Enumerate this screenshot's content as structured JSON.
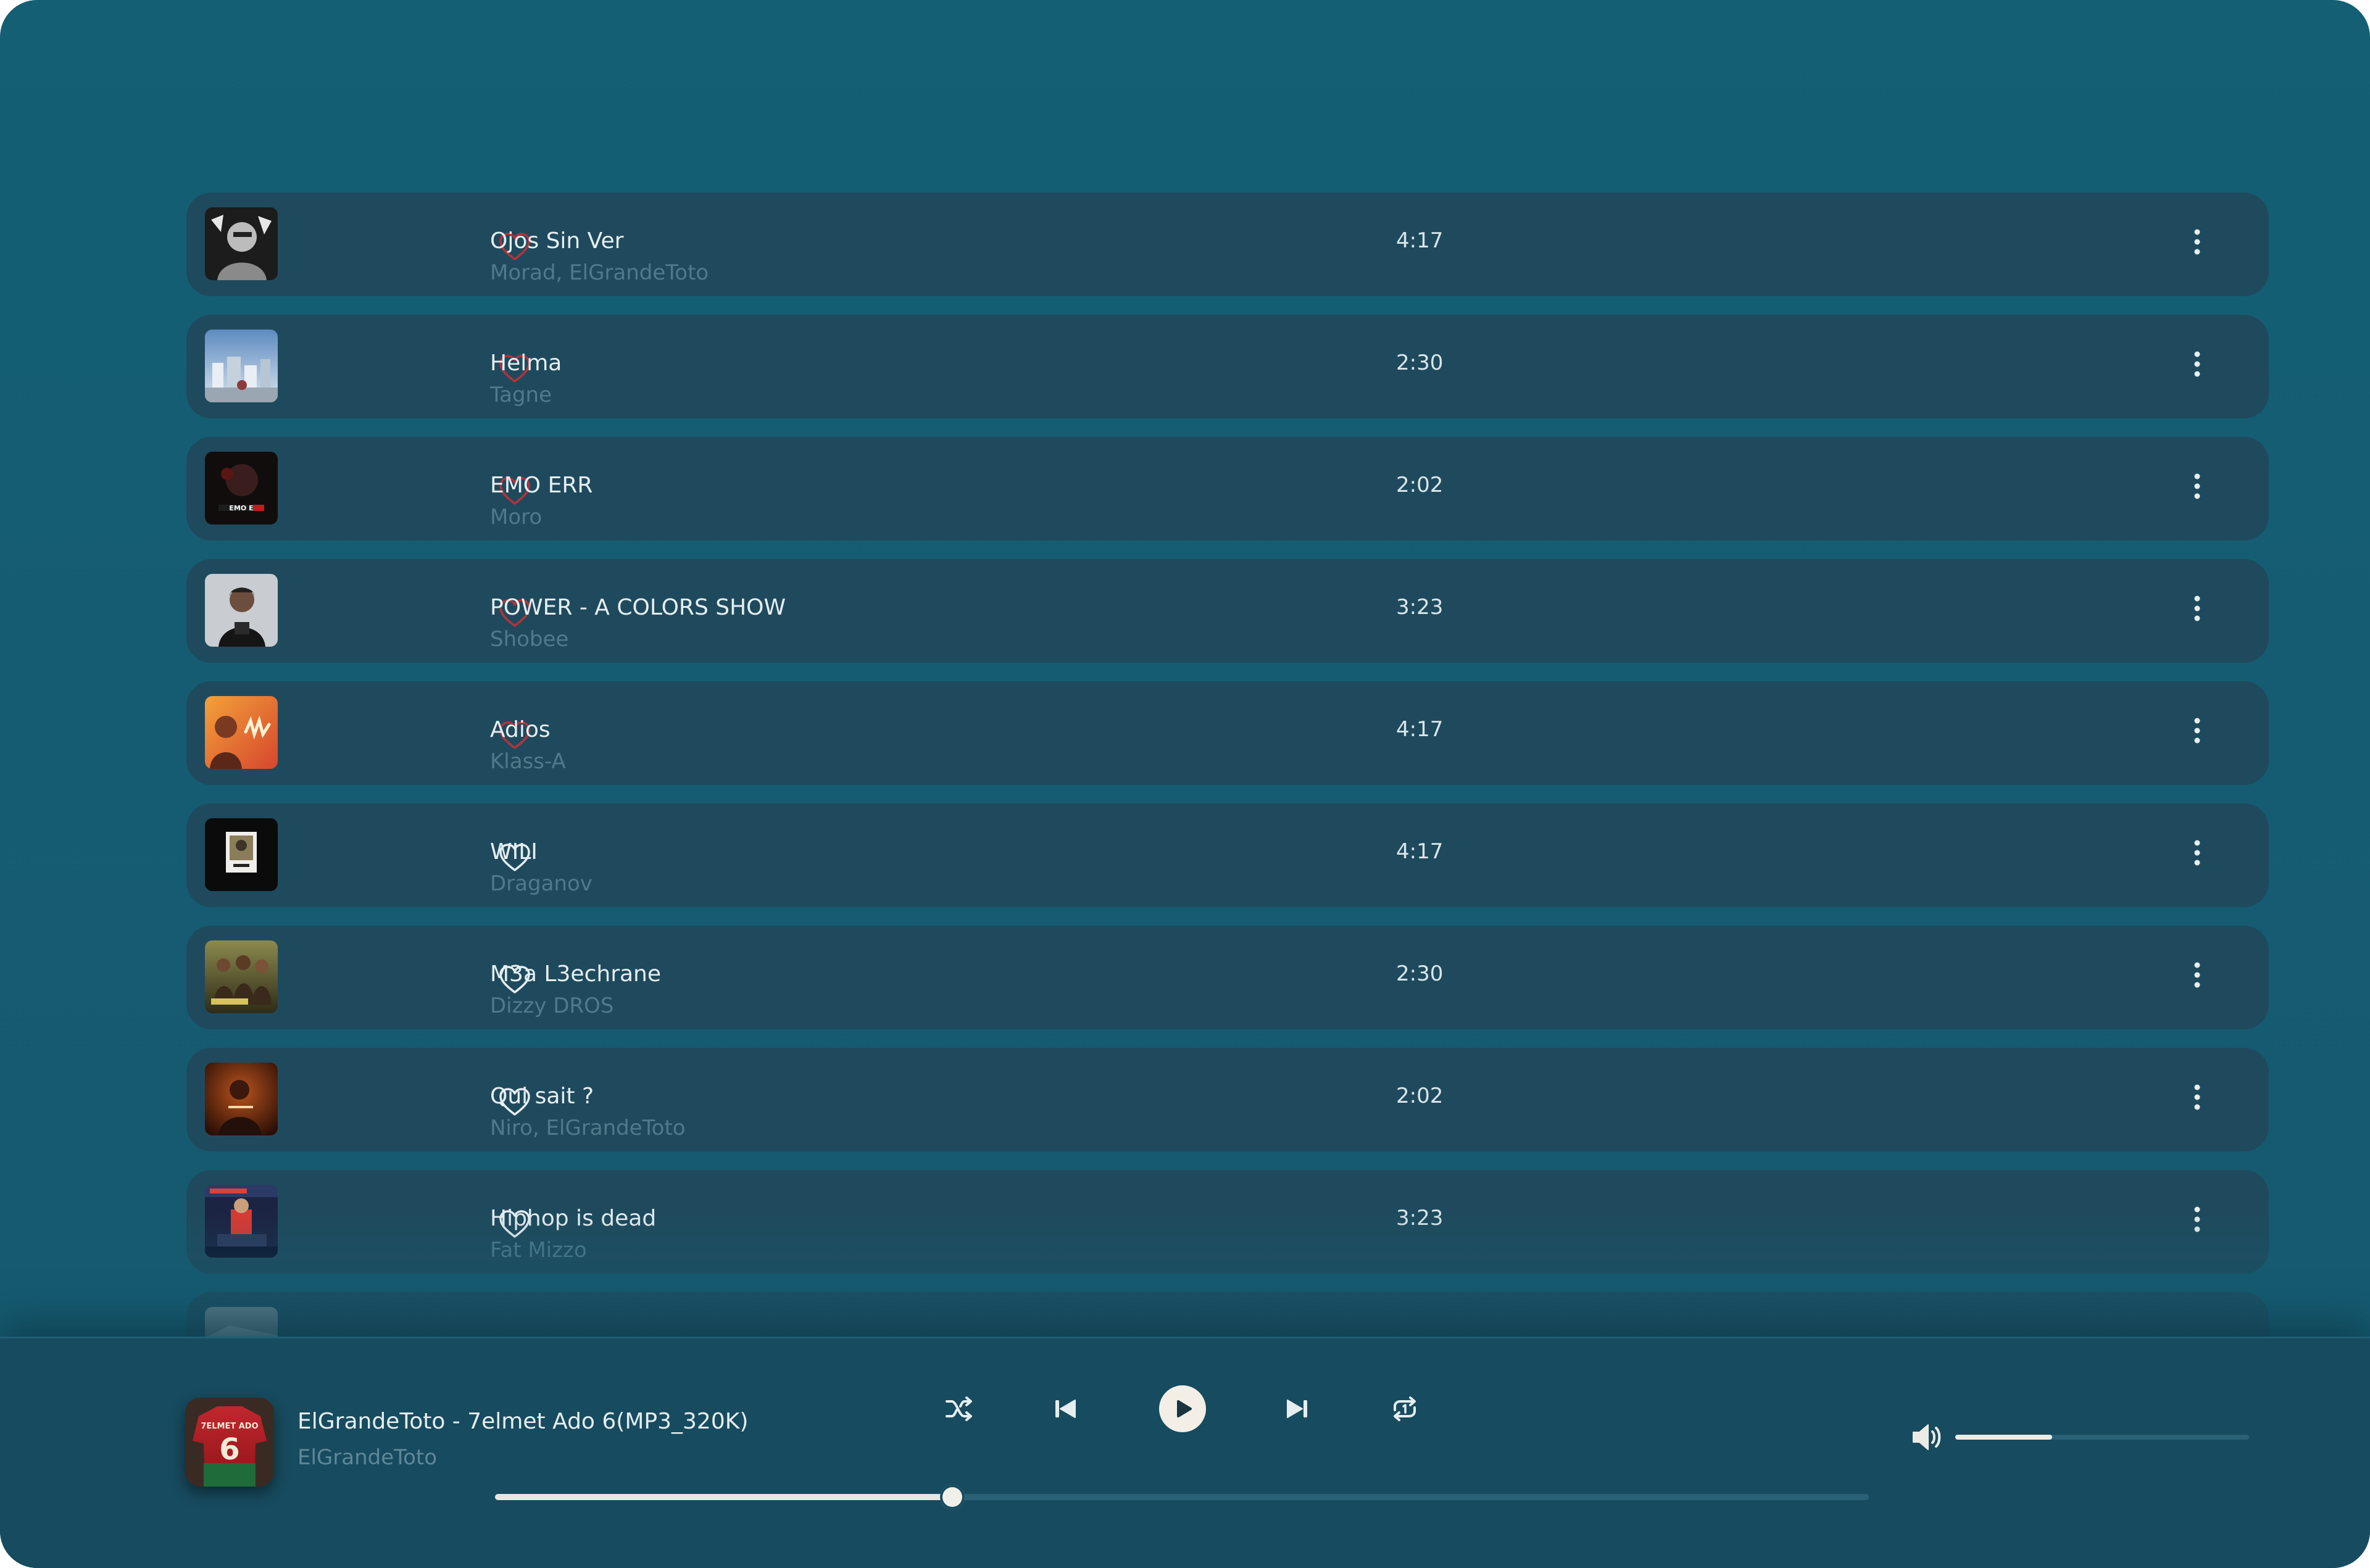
{
  "colors": {
    "background": "#145f74",
    "row": "#1f4a5d",
    "player": "#174b5f",
    "heart_liked": "#b4333a",
    "heart_default": "#e6eef2",
    "text_primary": "#e6eef2",
    "text_secondary": "#4e7a8c"
  },
  "songs": [
    {
      "title": "Ojos Sin Ver",
      "artist": "Morad, ElGrandeToto",
      "duration": "4:17",
      "liked": true,
      "cover": "bw-portrait"
    },
    {
      "title": "Helma",
      "artist": "Tagne",
      "duration": "2:30",
      "liked": true,
      "cover": "city-sky"
    },
    {
      "title": "EMO ERR",
      "artist": "Moro",
      "duration": "2:02",
      "liked": true,
      "cover": "dark-red"
    },
    {
      "title": "POWER - A COLORS SHOW",
      "artist": "Shobee",
      "duration": "3:23",
      "liked": true,
      "cover": "grey-portrait"
    },
    {
      "title": "Adios",
      "artist": "Klass-A",
      "duration": "4:17",
      "liked": true,
      "cover": "orange"
    },
    {
      "title": "WILI",
      "artist": "Draganov",
      "duration": "4:17",
      "liked": false,
      "cover": "black-frame"
    },
    {
      "title": "M3a L3echrane",
      "artist": "Dizzy DROS",
      "duration": "2:30",
      "liked": false,
      "cover": "olive-group"
    },
    {
      "title": "Qui sait ?",
      "artist": "Niro, ElGrandeToto",
      "duration": "2:02",
      "liked": false,
      "cover": "amber-dark"
    },
    {
      "title": "Hiphop is dead",
      "artist": "Fat Mizzo",
      "duration": "3:23",
      "liked": false,
      "cover": "navy-red"
    },
    {
      "title": "",
      "artist": "",
      "duration": "",
      "liked": false,
      "cover": "grey"
    }
  ],
  "player": {
    "title": "ElGrandeToto - 7elmet Ado 6(MP3_320K)",
    "artist": "ElGrandeToto",
    "cover_text": "7ELMET ADO",
    "cover_number": "6",
    "progress": 0.333,
    "volume": 0.33,
    "icons": {
      "shuffle": "shuffle-icon",
      "previous": "skip-previous-icon",
      "play": "play-icon",
      "next": "skip-next-icon",
      "repeat": "repeat-one-icon",
      "volume": "volume-icon",
      "heart": "heart-icon",
      "more": "more-vertical-icon"
    }
  }
}
